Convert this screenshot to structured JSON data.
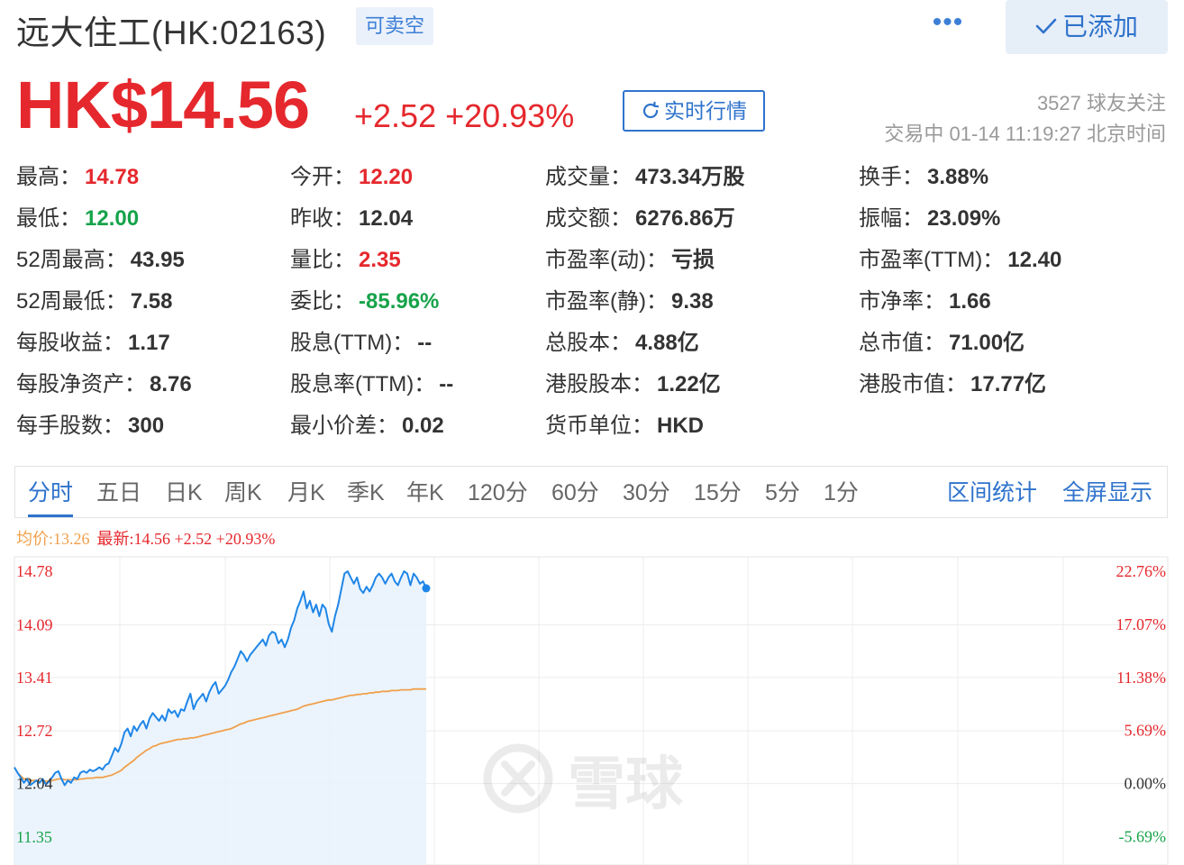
{
  "header": {
    "title": "远大住工(HK:02163)",
    "short_badge": "可卖空",
    "more": "•••",
    "added_label": "已添加",
    "check_icon": "check-icon"
  },
  "quote": {
    "price": "HK$14.56",
    "change": "+2.52 +20.93%",
    "realtime_label": "实时行情",
    "followers": "3527 球友关注",
    "status": "交易中 01-14 11:19:27 北京时间"
  },
  "stats": [
    {
      "label": "最高：",
      "value": "14.78",
      "tone": "up"
    },
    {
      "label": "今开：",
      "value": "12.20",
      "tone": "up"
    },
    {
      "label": "成交量：",
      "value": "473.34万股",
      "tone": ""
    },
    {
      "label": "换手：",
      "value": "3.88%",
      "tone": ""
    },
    {
      "label": "最低：",
      "value": "12.00",
      "tone": "down"
    },
    {
      "label": "昨收：",
      "value": "12.04",
      "tone": ""
    },
    {
      "label": "成交额：",
      "value": "6276.86万",
      "tone": ""
    },
    {
      "label": "振幅：",
      "value": "23.09%",
      "tone": ""
    },
    {
      "label": "52周最高：",
      "value": "43.95",
      "tone": ""
    },
    {
      "label": "量比：",
      "value": "2.35",
      "tone": "up"
    },
    {
      "label": "市盈率(动)：",
      "value": "亏损",
      "tone": ""
    },
    {
      "label": "市盈率(TTM)：",
      "value": "12.40",
      "tone": ""
    },
    {
      "label": "52周最低：",
      "value": "7.58",
      "tone": ""
    },
    {
      "label": "委比：",
      "value": "-85.96%",
      "tone": "down"
    },
    {
      "label": "市盈率(静)：",
      "value": "9.38",
      "tone": ""
    },
    {
      "label": "市净率：",
      "value": "1.66",
      "tone": ""
    },
    {
      "label": "每股收益：",
      "value": "1.17",
      "tone": ""
    },
    {
      "label": "股息(TTM)：",
      "value": "--",
      "tone": ""
    },
    {
      "label": "总股本：",
      "value": "4.88亿",
      "tone": ""
    },
    {
      "label": "总市值：",
      "value": "71.00亿",
      "tone": ""
    },
    {
      "label": "每股净资产：",
      "value": "8.76",
      "tone": ""
    },
    {
      "label": "股息率(TTM)：",
      "value": "--",
      "tone": ""
    },
    {
      "label": "港股股本：",
      "value": "1.22亿",
      "tone": ""
    },
    {
      "label": "港股市值：",
      "value": "17.77亿",
      "tone": ""
    },
    {
      "label": "每手股数：",
      "value": "300",
      "tone": ""
    },
    {
      "label": "最小价差：",
      "value": "0.02",
      "tone": ""
    },
    {
      "label": "货币单位：",
      "value": "HKD",
      "tone": ""
    }
  ],
  "tabs": [
    "分时",
    "五日",
    "日K",
    "周K",
    "月K",
    "季K",
    "年K",
    "120分",
    "60分",
    "30分",
    "15分",
    "5分",
    "1分"
  ],
  "tab_actions": [
    "区间统计",
    "全屏显示"
  ],
  "legend": {
    "avg": "均价:13.26",
    "latest": "最新:14.56 +2.52 +20.93%"
  },
  "watermark": "雪球",
  "colors": {
    "up": "#e5282d",
    "down": "#16a34a",
    "accent": "#2f73cc",
    "price_line": "#1f86e8",
    "avg_line": "#f0a04b"
  },
  "chart_data": {
    "type": "line",
    "y_left_ticks": [
      "14.78",
      "14.09",
      "13.41",
      "12.72",
      "12.04",
      "11.35"
    ],
    "y_right_ticks": [
      "22.76%",
      "17.07%",
      "11.38%",
      "5.69%",
      "0.00%",
      "-5.69%"
    ],
    "ylim": [
      11.35,
      14.78
    ],
    "prev_close": 12.04,
    "session_progress": 0.357,
    "series": [
      {
        "values": [
          12.25,
          12.18,
          12.12,
          12.05,
          12.1,
          12.02,
          12.05,
          12.08,
          12.05,
          12.1,
          12.03,
          12.07,
          12.12,
          12.18,
          12.2,
          12.1,
          12.02,
          12.08,
          12.05,
          12.12,
          12.1,
          12.18,
          12.2,
          12.18,
          12.22,
          12.2,
          12.22,
          12.25,
          12.22,
          12.28,
          12.3,
          12.4,
          12.5,
          12.45,
          12.55,
          12.7,
          12.75,
          12.65,
          12.78,
          12.72,
          12.8,
          12.85,
          12.75,
          12.88,
          12.95,
          12.9,
          12.85,
          12.92,
          12.85,
          13.0,
          12.95,
          12.98,
          12.9,
          13.0,
          12.98,
          13.1,
          13.2,
          13.0,
          13.1,
          13.15,
          13.2,
          13.1,
          13.22,
          13.3,
          13.35,
          13.2,
          13.25,
          13.3,
          13.38,
          13.48,
          13.55,
          13.65,
          13.75,
          13.7,
          13.62,
          13.7,
          13.75,
          13.8,
          13.85,
          13.9,
          13.82,
          13.95,
          14.0,
          13.98,
          13.85,
          13.9,
          13.8,
          13.9,
          14.05,
          14.15,
          14.3,
          14.4,
          14.52,
          14.3,
          14.4,
          14.25,
          14.35,
          14.2,
          14.35,
          14.3,
          14.1,
          14.0,
          14.2,
          14.35,
          14.55,
          14.75,
          14.78,
          14.7,
          14.62,
          14.7,
          14.55,
          14.5,
          14.58,
          14.52,
          14.6,
          14.7,
          14.75,
          14.7,
          14.62,
          14.7,
          14.75,
          14.65,
          14.6,
          14.7,
          14.78,
          14.75,
          14.6,
          14.75,
          14.7,
          14.62,
          14.65,
          14.56
        ]
      },
      {
        "name": "均价",
        "values": [
          12.25,
          12.18,
          12.14,
          12.1,
          12.1,
          12.08,
          12.08,
          12.08,
          12.07,
          12.08,
          12.07,
          12.07,
          12.08,
          12.09,
          12.1,
          12.1,
          12.09,
          12.09,
          12.09,
          12.09,
          12.09,
          12.1,
          12.1,
          12.11,
          12.11,
          12.11,
          12.12,
          12.12,
          12.12,
          12.13,
          12.14,
          12.15,
          12.17,
          12.19,
          12.21,
          12.25,
          12.28,
          12.31,
          12.34,
          12.38,
          12.41,
          12.44,
          12.47,
          12.49,
          12.52,
          12.53,
          12.55,
          12.56,
          12.57,
          12.58,
          12.59,
          12.6,
          12.61,
          12.61,
          12.62,
          12.62,
          12.63,
          12.63,
          12.64,
          12.65,
          12.66,
          12.67,
          12.68,
          12.69,
          12.7,
          12.71,
          12.72,
          12.73,
          12.74,
          12.75,
          12.77,
          12.79,
          12.81,
          12.82,
          12.84,
          12.85,
          12.86,
          12.87,
          12.88,
          12.89,
          12.9,
          12.91,
          12.92,
          12.93,
          12.94,
          12.95,
          12.96,
          12.97,
          12.98,
          12.99,
          13.0,
          13.02,
          13.04,
          13.05,
          13.06,
          13.07,
          13.08,
          13.09,
          13.1,
          13.11,
          13.12,
          13.12,
          13.13,
          13.14,
          13.15,
          13.16,
          13.17,
          13.18,
          13.18,
          13.19,
          13.19,
          13.2,
          13.2,
          13.21,
          13.21,
          13.22,
          13.22,
          13.23,
          13.23,
          13.23,
          13.24,
          13.24,
          13.24,
          13.25,
          13.25,
          13.25,
          13.25,
          13.26,
          13.26,
          13.26,
          13.26,
          13.26
        ]
      }
    ]
  }
}
